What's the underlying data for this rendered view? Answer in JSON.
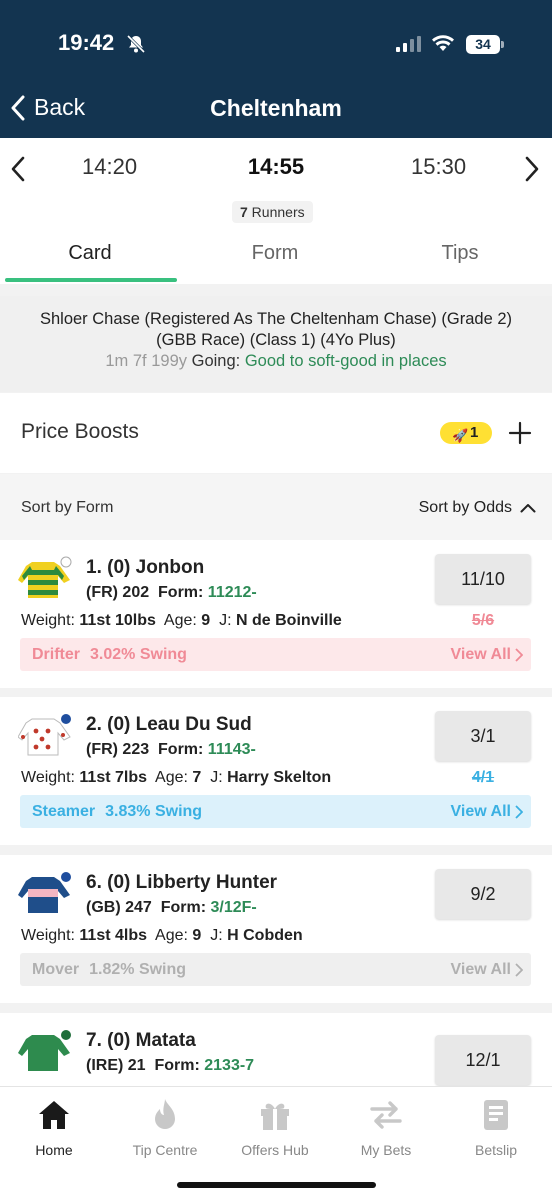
{
  "status": {
    "time": "19:42",
    "battery": "34"
  },
  "header": {
    "back_label": "Back",
    "title": "Cheltenham"
  },
  "race_nav": {
    "prev_time": "14:20",
    "current_time": "14:55",
    "next_time": "15:30",
    "runners_count": "7",
    "runners_label": " Runners"
  },
  "tabs": [
    {
      "label": "Card",
      "active": true
    },
    {
      "label": "Form",
      "active": false
    },
    {
      "label": "Tips",
      "active": false
    }
  ],
  "race_info": {
    "name": "Shloer Chase (Registered As The Cheltenham Chase) (Grade 2) (GBB Race) (Class 1) (4Yo Plus)",
    "distance": "1m 7f 199y",
    "going_label": "Going:",
    "going": "Good to soft-good in places"
  },
  "price_boosts": {
    "label": "Price Boosts",
    "count": "1"
  },
  "sort": {
    "form_label": "Sort by Form",
    "odds_label": "Sort by Odds"
  },
  "runners": [
    {
      "name": "1. (0) Jonbon",
      "origin_rating": "(FR) 202",
      "form_label": "Form:",
      "form": "11212-",
      "weight_label": "Weight:",
      "weight": "11st 10lbs",
      "age_label": "Age:",
      "age": "9",
      "jockey_label": "J:",
      "jockey": "N de Boinville",
      "odds": "11/10",
      "prev_odds": "5/6",
      "swing_type": "Drifter",
      "swing_pct": "3.02% Swing",
      "view_all": "View All"
    },
    {
      "name": "2. (0) Leau Du Sud",
      "origin_rating": "(FR) 223",
      "form_label": "Form:",
      "form": "11143-",
      "weight_label": "Weight:",
      "weight": "11st 7lbs",
      "age_label": "Age:",
      "age": "7",
      "jockey_label": "J:",
      "jockey": "Harry Skelton",
      "odds": "3/1",
      "prev_odds": "4/1",
      "swing_type": "Steamer",
      "swing_pct": "3.83% Swing",
      "view_all": "View All"
    },
    {
      "name": "6. (0) Libberty Hunter",
      "origin_rating": "(GB) 247",
      "form_label": "Form:",
      "form": "3/12F-",
      "weight_label": "Weight:",
      "weight": "11st 4lbs",
      "age_label": "Age:",
      "age": "9",
      "jockey_label": "J:",
      "jockey": "H Cobden",
      "odds": "9/2",
      "prev_odds": "",
      "swing_type": "Mover",
      "swing_pct": "1.82% Swing",
      "view_all": "View All"
    },
    {
      "name": "7. (0) Matata",
      "origin_rating": "(IRE) 21",
      "form_label": "Form:",
      "form": "2133-7",
      "odds": "12/1"
    }
  ],
  "bottom_nav": [
    {
      "label": "Home",
      "icon": "home-icon",
      "active": true
    },
    {
      "label": "Tip Centre",
      "icon": "flame-icon",
      "active": false
    },
    {
      "label": "Offers Hub",
      "icon": "gift-icon",
      "active": false
    },
    {
      "label": "My Bets",
      "icon": "swap-arrows-icon",
      "active": false
    },
    {
      "label": "Betslip",
      "icon": "betslip-icon",
      "active": false
    }
  ],
  "colors": {
    "header_bg": "#133450",
    "accent_green": "#39c07f",
    "form_green": "#2e8b57",
    "drifter": "#f08a96",
    "steamer": "#3ab0e2",
    "mover": "#b0b0b0"
  }
}
